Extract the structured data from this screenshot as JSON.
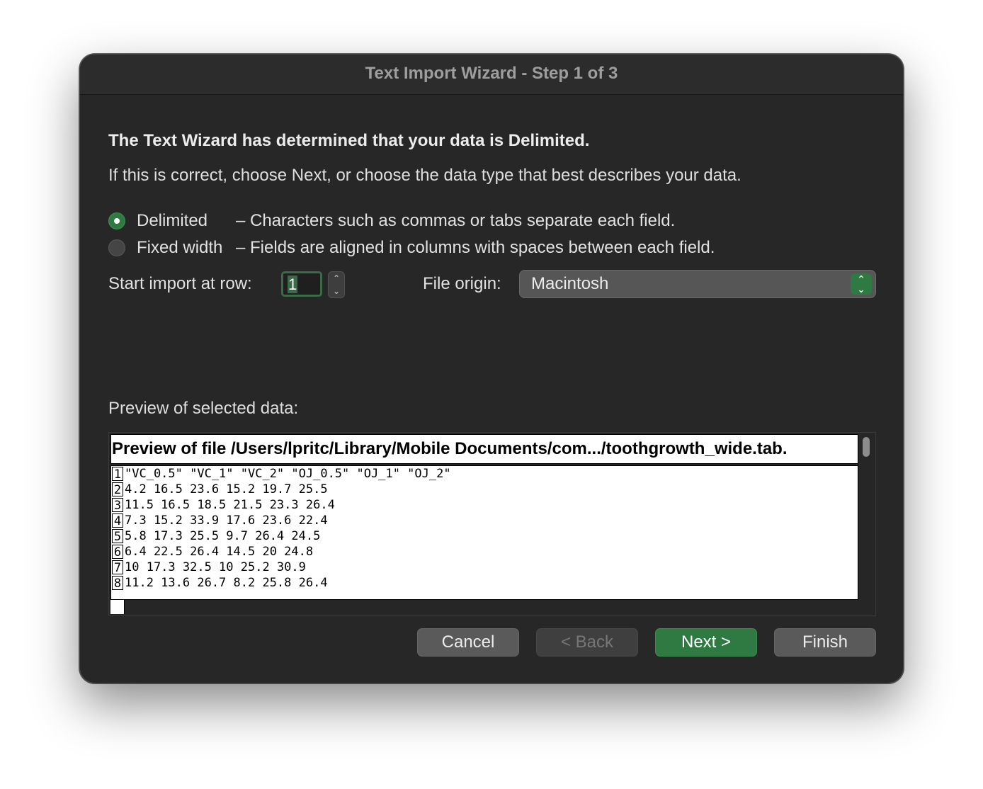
{
  "window": {
    "title": "Text Import Wizard - Step 1 of 3"
  },
  "intro": {
    "headline": "The Text Wizard has determined that your data is Delimited.",
    "subline": "If this is correct, choose Next, or choose the data type that best describes your data."
  },
  "data_type": {
    "options": [
      {
        "label": "Delimited",
        "description": "– Characters such as commas or tabs separate each field.",
        "selected": true
      },
      {
        "label": "Fixed width",
        "description": "– Fields are aligned in columns with spaces between each field.",
        "selected": false
      }
    ]
  },
  "start_row": {
    "label": "Start import at row:",
    "value": "1"
  },
  "file_origin": {
    "label": "File origin:",
    "value": "Macintosh"
  },
  "preview": {
    "label": "Preview of selected data:",
    "header": "Preview of file /Users/lpritc/Library/Mobile Documents/com.../toothgrowth_wide.tab.",
    "rows": [
      {
        "num": "1",
        "text": "\"VC_0.5\" \"VC_1\" \"VC_2\" \"OJ_0.5\" \"OJ_1\" \"OJ_2\""
      },
      {
        "num": "2",
        "text": "4.2 16.5 23.6 15.2 19.7 25.5"
      },
      {
        "num": "3",
        "text": "11.5 16.5 18.5 21.5 23.3 26.4"
      },
      {
        "num": "4",
        "text": "7.3 15.2 33.9 17.6 23.6 22.4"
      },
      {
        "num": "5",
        "text": "5.8 17.3 25.5 9.7 26.4 24.5"
      },
      {
        "num": "6",
        "text": "6.4 22.5 26.4 14.5 20 24.8"
      },
      {
        "num": "7",
        "text": "10 17.3 32.5 10 25.2 30.9"
      },
      {
        "num": "8",
        "text": "11.2 13.6 26.7 8.2 25.8 26.4"
      }
    ]
  },
  "buttons": {
    "cancel": "Cancel",
    "back": "< Back",
    "next": "Next >",
    "finish": "Finish"
  },
  "colors": {
    "window_bg": "#272727",
    "accent": "#2f7a42",
    "text": "#e2e2e2"
  },
  "icons": {
    "stepper_up": "chevron-up-icon",
    "stepper_down": "chevron-down-icon",
    "select": "up-down-chevron-icon"
  }
}
